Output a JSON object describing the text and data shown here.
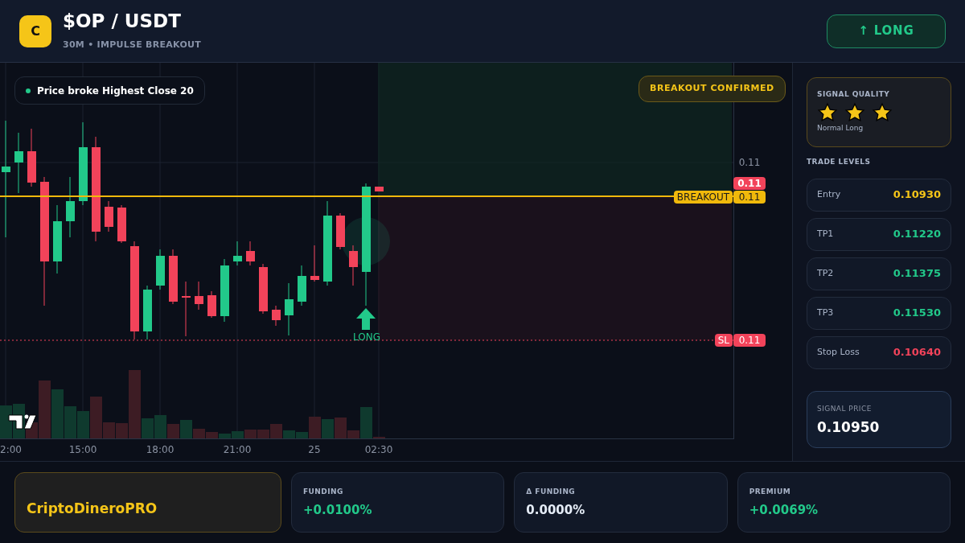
{
  "header": {
    "logo_letter": "C",
    "pair": "$OP / USDT",
    "subtitle": "30M • IMPULSE BREAKOUT",
    "direction_button": {
      "arrow": "↑",
      "label": "LONG"
    }
  },
  "chart": {
    "legend": "Price broke Highest Close 20",
    "badge": "BREAKOUT CONFIRMED",
    "price_axis": [
      {
        "kind": "plain",
        "value": "0.11"
      },
      {
        "kind": "current",
        "value": "0.11"
      },
      {
        "kind": "breakout",
        "tag": "BREAKOUT",
        "value": "0.11"
      },
      {
        "kind": "stop",
        "tag": "SL",
        "value": "0.11"
      }
    ],
    "signal_marker": "LONG",
    "time_axis": [
      "2:00",
      "15:00",
      "18:00",
      "21:00",
      "25",
      "02:30"
    ]
  },
  "sidebar": {
    "signal_quality": {
      "title": "SIGNAL QUALITY",
      "stars": 3,
      "label": "Normal Long"
    },
    "trade_levels_title": "TRADE LEVELS",
    "levels": [
      {
        "label": "Entry",
        "value": "0.10930",
        "kind": "entry"
      },
      {
        "label": "TP1",
        "value": "0.11220",
        "kind": "target"
      },
      {
        "label": "TP2",
        "value": "0.11375",
        "kind": "target"
      },
      {
        "label": "TP3",
        "value": "0.11530",
        "kind": "target"
      },
      {
        "label": "Stop Loss",
        "value": "0.10640",
        "kind": "stop"
      }
    ],
    "signal_price": {
      "title": "SIGNAL PRICE",
      "value": "0.10950"
    }
  },
  "footer": {
    "brand": "CriptoDineroPRO",
    "metrics": [
      {
        "label": "FUNDING",
        "value": "+0.0100%",
        "kind": "positive"
      },
      {
        "label": "Δ FUNDING",
        "value": "0.0000%",
        "kind": "neutral"
      },
      {
        "label": "PREMIUM",
        "value": "+0.0069%",
        "kind": "positive"
      }
    ]
  }
}
